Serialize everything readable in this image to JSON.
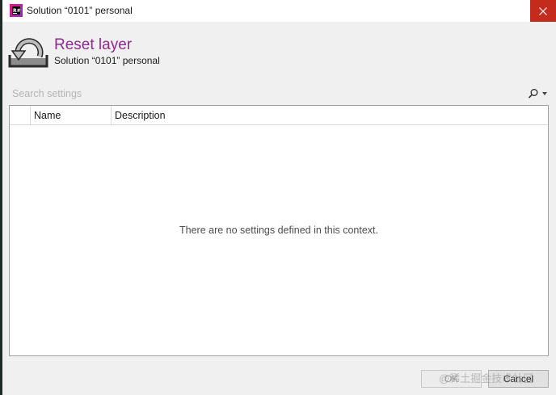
{
  "window": {
    "title": "Solution “0101” personal",
    "app_icon": "resharper-icon",
    "close_icon": "close-icon"
  },
  "header": {
    "title": "Reset layer",
    "subtitle": "Solution “0101” personal",
    "icon": "reset-arrow-icon"
  },
  "search": {
    "placeholder": "Search settings",
    "value": ""
  },
  "grid": {
    "columns": [
      "",
      "Name",
      "Description"
    ],
    "empty_message": "There are no settings defined in this context."
  },
  "buttons": {
    "ok_label": "OK",
    "cancel_label": "Cancel"
  },
  "watermark": "@稀土掘金技术社区",
  "colors": {
    "title_accent": "#8d2a8f",
    "close_button": "#c42b1c"
  }
}
